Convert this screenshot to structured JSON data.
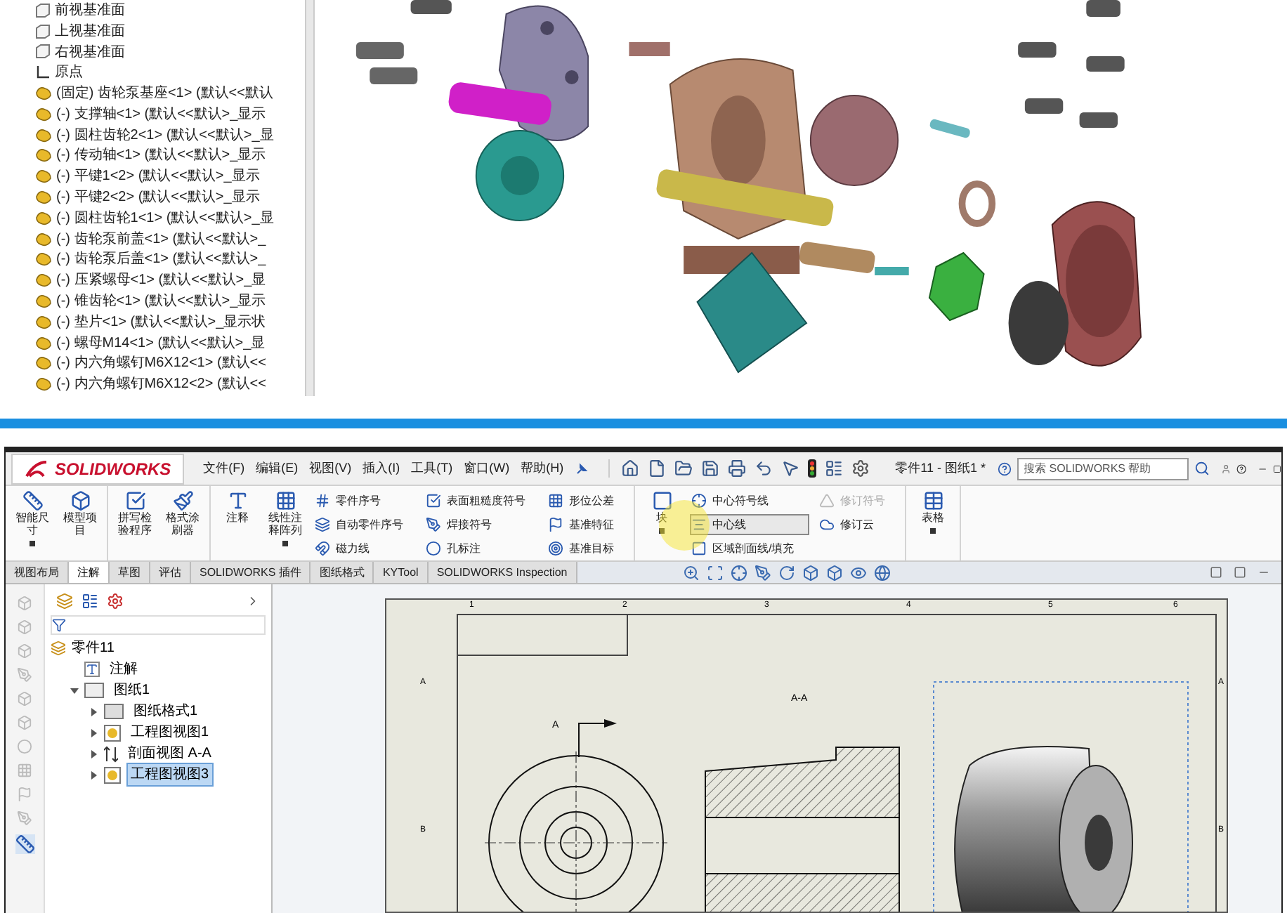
{
  "assembly_tree": {
    "items": [
      {
        "kind": "plane",
        "label": "前视基准面"
      },
      {
        "kind": "plane",
        "label": "上视基准面"
      },
      {
        "kind": "plane",
        "label": "右视基准面"
      },
      {
        "kind": "origin",
        "label": "原点"
      },
      {
        "kind": "part",
        "label": "(固定) 齿轮泵基座<1> (默认<<默认"
      },
      {
        "kind": "part",
        "label": "(-) 支撑轴<1> (默认<<默认>_显示"
      },
      {
        "kind": "part",
        "label": "(-) 圆柱齿轮2<1> (默认<<默认>_显"
      },
      {
        "kind": "part",
        "label": "(-) 传动轴<1> (默认<<默认>_显示"
      },
      {
        "kind": "part",
        "label": "(-) 平键1<2> (默认<<默认>_显示"
      },
      {
        "kind": "part",
        "label": "(-) 平键2<2> (默认<<默认>_显示"
      },
      {
        "kind": "part",
        "label": "(-) 圆柱齿轮1<1> (默认<<默认>_显"
      },
      {
        "kind": "part",
        "label": "(-) 齿轮泵前盖<1> (默认<<默认>_"
      },
      {
        "kind": "part",
        "label": "(-) 齿轮泵后盖<1> (默认<<默认>_"
      },
      {
        "kind": "part",
        "label": "(-) 压紧螺母<1> (默认<<默认>_显"
      },
      {
        "kind": "part",
        "label": "(-) 锥齿轮<1> (默认<<默认>_显示"
      },
      {
        "kind": "part",
        "label": "(-) 垫片<1> (默认<<默认>_显示状"
      },
      {
        "kind": "part",
        "label": "(-) 螺母M14<1> (默认<<默认>_显"
      },
      {
        "kind": "part",
        "label": "(-) 内六角螺钉M6X12<1> (默认<<"
      },
      {
        "kind": "part",
        "label": "(-) 内六角螺钉M6X12<2> (默认<<"
      }
    ]
  },
  "app": {
    "logo": "SOLIDWORKS",
    "menu": [
      "文件(F)",
      "编辑(E)",
      "视图(V)",
      "插入(I)",
      "工具(T)",
      "窗口(W)",
      "帮助(H)"
    ],
    "document_title": "零件11 - 图纸1 *",
    "search": {
      "placeholder": "搜索 SOLIDWORKS 帮助"
    },
    "ribbon": {
      "groups": [
        [
          {
            "kind": "large",
            "label": "智能尺寸",
            "menu": true
          },
          {
            "kind": "large",
            "label": "模型项目",
            "menu": false
          }
        ],
        [
          {
            "kind": "large",
            "label": "拼写检验程序",
            "menu": false
          },
          {
            "kind": "large",
            "label": "格式涂刷器",
            "menu": false
          }
        ],
        [
          {
            "kind": "large",
            "label": "注释",
            "menu": false
          },
          {
            "kind": "large",
            "label": "线性注释阵列",
            "menu": true
          },
          {
            "kind": "column",
            "items": [
              {
                "label": "零件序号",
                "disabled": false,
                "highlighted": false
              },
              {
                "label": "自动零件序号",
                "disabled": false,
                "highlighted": false
              },
              {
                "label": "磁力线",
                "disabled": false,
                "highlighted": false
              }
            ]
          },
          {
            "kind": "column",
            "items": [
              {
                "label": "表面粗糙度符号",
                "disabled": false,
                "highlighted": false
              },
              {
                "label": "焊接符号",
                "disabled": false,
                "highlighted": false
              },
              {
                "label": "孔标注",
                "disabled": false,
                "highlighted": false
              }
            ]
          },
          {
            "kind": "column",
            "items": [
              {
                "label": "形位公差",
                "disabled": false,
                "highlighted": false
              },
              {
                "label": "基准特征",
                "disabled": false,
                "highlighted": false
              },
              {
                "label": "基准目标",
                "disabled": false,
                "highlighted": false
              }
            ]
          }
        ],
        [
          {
            "kind": "large",
            "label": "块",
            "menu": true
          },
          {
            "kind": "column",
            "items": [
              {
                "label": "中心符号线",
                "disabled": false,
                "highlighted": false
              },
              {
                "label": "中心线",
                "disabled": false,
                "highlighted": true
              },
              {
                "label": "区域剖面线/填充",
                "disabled": false,
                "highlighted": false
              }
            ]
          },
          {
            "kind": "column",
            "items": [
              {
                "label": "修订符号",
                "disabled": true,
                "highlighted": false
              },
              {
                "label": "修订云",
                "disabled": false,
                "highlighted": false
              }
            ]
          }
        ],
        [
          {
            "kind": "large",
            "label": "表格",
            "menu": true
          }
        ]
      ]
    },
    "tabs": [
      {
        "label": "视图布局",
        "selected": false
      },
      {
        "label": "注解",
        "selected": true
      },
      {
        "label": "草图",
        "selected": false
      },
      {
        "label": "评估",
        "selected": false
      },
      {
        "label": "SOLIDWORKS 插件",
        "selected": false
      },
      {
        "label": "图纸格式",
        "selected": false
      },
      {
        "label": "KYTool",
        "selected": false
      },
      {
        "label": "SOLIDWORKS Inspection",
        "selected": false
      }
    ],
    "feature_tree": {
      "root": {
        "label": "零件11",
        "children": [
          {
            "kind": "annotations",
            "label": "注解",
            "selected": false
          },
          {
            "kind": "sheet",
            "label": "图纸1",
            "expanded": true,
            "selected": false,
            "children": [
              {
                "kind": "format",
                "label": "图纸格式1",
                "expanded": false,
                "selected": false
              },
              {
                "kind": "view",
                "label": "工程图视图1",
                "expanded": false,
                "selected": false
              },
              {
                "kind": "section",
                "label": "剖面视图 A-A",
                "expanded": false,
                "selected": false
              },
              {
                "kind": "view",
                "label": "工程图视图3",
                "expanded": false,
                "selected": true
              }
            ]
          }
        ]
      }
    },
    "sheet": {
      "zone_numbers": [
        "1",
        "2",
        "3",
        "4",
        "5",
        "6"
      ],
      "left_rows": [
        "A",
        "B"
      ],
      "right_rows": [
        "A",
        "B"
      ],
      "section_label": "A",
      "section_view_title": "A-A"
    }
  }
}
